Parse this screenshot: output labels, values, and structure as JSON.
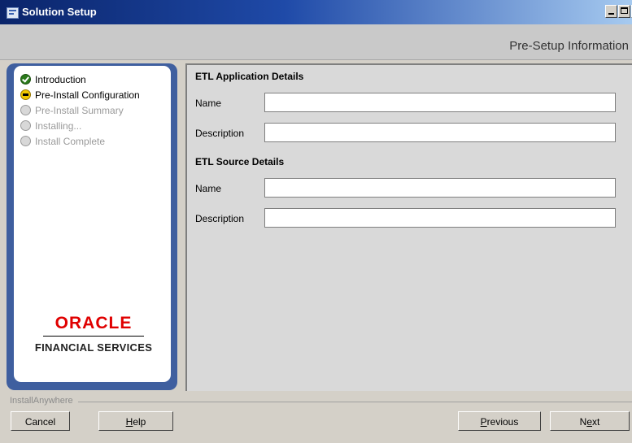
{
  "window": {
    "title": "Solution Setup"
  },
  "header": {
    "title": "Pre-Setup Information"
  },
  "steps": [
    {
      "label": "Introduction",
      "state": "done"
    },
    {
      "label": "Pre-Install Configuration",
      "state": "current"
    },
    {
      "label": "Pre-Install Summary",
      "state": "pending"
    },
    {
      "label": "Installing...",
      "state": "pending"
    },
    {
      "label": "Install Complete",
      "state": "pending"
    }
  ],
  "logo": {
    "brand": "ORACLE",
    "subtitle": "FINANCIAL SERVICES"
  },
  "form": {
    "etl_app": {
      "heading": "ETL Application Details",
      "name_label": "Name",
      "name_value": "",
      "desc_label": "Description",
      "desc_value": ""
    },
    "etl_source": {
      "heading": "ETL Source Details",
      "name_label": "Name",
      "name_value": "",
      "desc_label": "Description",
      "desc_value": ""
    }
  },
  "footer": {
    "brand": "InstallAnywhere",
    "cancel": "Cancel",
    "help_mnemonic": "H",
    "help_rest": "elp",
    "previous_mnemonic": "P",
    "previous_rest": "revious",
    "next_prefix": "N",
    "next_mnemonic": "e",
    "next_rest": "xt"
  },
  "colors": {
    "titlebar": "#0a246a",
    "logo_red": "#e00000",
    "panel_border": "#3f5f9f"
  }
}
